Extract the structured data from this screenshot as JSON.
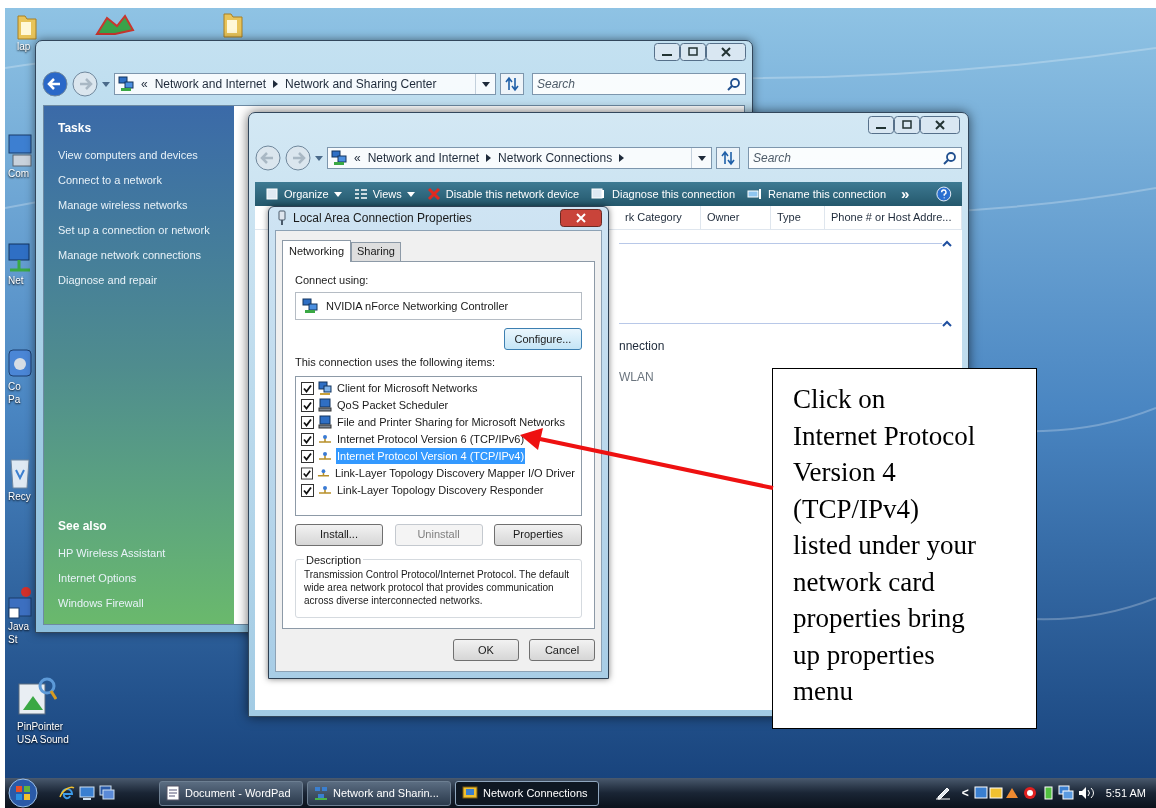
{
  "desktop_icons": [
    {
      "kind": "folder",
      "lines": [
        "lap"
      ]
    },
    {
      "kind": "chart"
    },
    {
      "kind": "folder"
    },
    {
      "kind": "computer",
      "lines": [
        "Com"
      ]
    },
    {
      "kind": "network",
      "lines": [
        "Net"
      ]
    },
    {
      "kind": "panel",
      "lines": [
        "Co",
        "Pa"
      ]
    },
    {
      "kind": "bin",
      "lines": [
        "Recy"
      ]
    },
    {
      "kind": "java",
      "lines": [
        "Java",
        "St"
      ]
    },
    {
      "kind": "photo",
      "lines": [
        "PinPointer",
        "USA Sound"
      ]
    }
  ],
  "sharing_center_window": {
    "overflow_mark": "«",
    "breadcrumb": [
      "Network and Internet",
      "Network and Sharing Center"
    ],
    "search": {
      "placeholder": "Search"
    },
    "tasks_heading": "Tasks",
    "tasks": [
      "View computers and devices",
      "Connect to a network",
      "Manage wireless networks",
      "Set up a connection or network",
      "Manage network connections",
      "Diagnose and repair"
    ],
    "see_also_heading": "See also",
    "see_also": [
      "HP Wireless Assistant",
      "Internet Options",
      "Windows Firewall"
    ]
  },
  "connections_window": {
    "overflow_mark": "«",
    "breadcrumb": [
      "Network and Internet",
      "Network Connections"
    ],
    "search": {
      "placeholder": "Search"
    },
    "toolbar": [
      {
        "label": "Organize",
        "dropdown": true
      },
      {
        "label": "Views",
        "dropdown": true
      },
      {
        "label": "Disable this network device",
        "dropdown": false
      },
      {
        "label": "Diagnose this connection",
        "dropdown": false
      },
      {
        "label": "Rename this connection",
        "dropdown": false
      }
    ],
    "more_mark": "»",
    "columns": [
      "rk Category",
      "Owner",
      "Type",
      "Phone # or Host Addre..."
    ],
    "items": [
      "nnection",
      "WLAN"
    ]
  },
  "properties_dialog": {
    "title": "Local Area Connection Properties",
    "tabs": [
      {
        "label": "Networking",
        "selected": true
      },
      {
        "label": "Sharing",
        "selected": false
      }
    ],
    "connect_using_label": "Connect using:",
    "adapter": "NVIDIA nForce Networking Controller",
    "configure_button": "Configure...",
    "items_label": "This connection uses the following items:",
    "items": [
      {
        "label": "Client for Microsoft Networks",
        "checked": true,
        "selected": false,
        "kind": "client"
      },
      {
        "label": "QoS Packet Scheduler",
        "checked": true,
        "selected": false,
        "kind": "service"
      },
      {
        "label": "File and Printer Sharing for Microsoft Networks",
        "checked": true,
        "selected": false,
        "kind": "service"
      },
      {
        "label": "Internet Protocol Version 6 (TCP/IPv6)",
        "checked": true,
        "selected": false,
        "kind": "protocol"
      },
      {
        "label": "Internet Protocol Version 4 (TCP/IPv4)",
        "checked": true,
        "selected": true,
        "kind": "protocol"
      },
      {
        "label": "Link-Layer Topology Discovery Mapper I/O Driver",
        "checked": true,
        "selected": false,
        "kind": "protocol"
      },
      {
        "label": "Link-Layer Topology Discovery Responder",
        "checked": true,
        "selected": false,
        "kind": "protocol"
      }
    ],
    "buttons": [
      {
        "label": "Install...",
        "disabled": false
      },
      {
        "label": "Uninstall",
        "disabled": true
      },
      {
        "label": "Properties",
        "disabled": false
      }
    ],
    "description_label": "Description",
    "description": "Transmission Control Protocol/Internet Protocol. The default wide area network protocol that provides communication across diverse interconnected networks.",
    "ok_button": "OK",
    "cancel_button": "Cancel"
  },
  "callout": {
    "lines": [
      "Click on",
      "Internet Protocol",
      "Version 4",
      "(TCP/IPv4)",
      "listed under your",
      "network card",
      "properties bring",
      "up properties",
      "menu"
    ]
  },
  "taskbar": {
    "tasks": [
      {
        "label": "Document - WordPad",
        "selected": false
      },
      {
        "label": "Network and Sharin...",
        "selected": false
      },
      {
        "label": "Network Connections",
        "selected": true
      }
    ],
    "tray_mark": "<",
    "clock": "5:51 AM"
  }
}
